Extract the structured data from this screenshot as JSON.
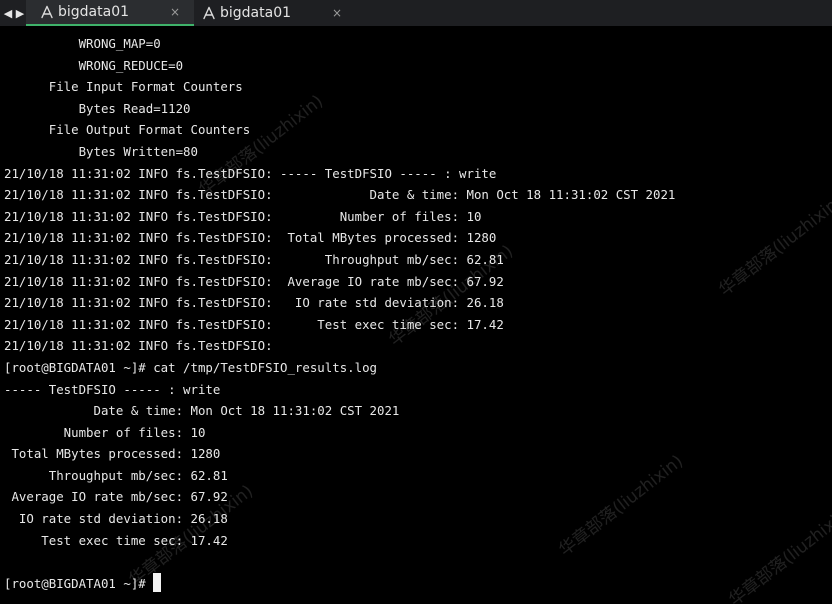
{
  "tabs": [
    {
      "label": "bigdata01",
      "active": true,
      "close": "×"
    },
    {
      "label": "bigdata01",
      "active": false,
      "close": "×"
    }
  ],
  "nav": {
    "back": "◀",
    "forward": "▶"
  },
  "terminal": {
    "lines": [
      "          WRONG_MAP=0",
      "          WRONG_REDUCE=0",
      "      File Input Format Counters ",
      "          Bytes Read=1120",
      "      File Output Format Counters ",
      "          Bytes Written=80",
      "21/10/18 11:31:02 INFO fs.TestDFSIO: ----- TestDFSIO ----- : write",
      "21/10/18 11:31:02 INFO fs.TestDFSIO:             Date & time: Mon Oct 18 11:31:02 CST 2021",
      "21/10/18 11:31:02 INFO fs.TestDFSIO:         Number of files: 10",
      "21/10/18 11:31:02 INFO fs.TestDFSIO:  Total MBytes processed: 1280",
      "21/10/18 11:31:02 INFO fs.TestDFSIO:       Throughput mb/sec: 62.81",
      "21/10/18 11:31:02 INFO fs.TestDFSIO:  Average IO rate mb/sec: 67.92",
      "21/10/18 11:31:02 INFO fs.TestDFSIO:   IO rate std deviation: 26.18",
      "21/10/18 11:31:02 INFO fs.TestDFSIO:      Test exec time sec: 17.42",
      "21/10/18 11:31:02 INFO fs.TestDFSIO: ",
      "[root@BIGDATA01 ~]# cat /tmp/TestDFSIO_results.log",
      "----- TestDFSIO ----- : write",
      "            Date & time: Mon Oct 18 11:31:02 CST 2021",
      "        Number of files: 10",
      " Total MBytes processed: 1280",
      "      Throughput mb/sec: 62.81",
      " Average IO rate mb/sec: 67.92",
      "  IO rate std deviation: 26.18",
      "     Test exec time sec: 17.42",
      "",
      "[root@BIGDATA01 ~]# "
    ]
  },
  "watermark": {
    "text": "华章部落(liuzhixin)"
  },
  "colors": {
    "background": "#000000",
    "text": "#e8e8e8",
    "tabbar": "#1e1f22",
    "active_tab": "#2b2d30",
    "active_tab_underline": "#3fb26a"
  }
}
